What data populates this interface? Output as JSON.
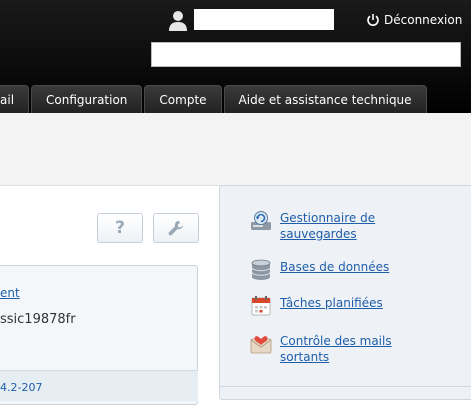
{
  "header": {
    "logout_label": "Déconnexion"
  },
  "nav": {
    "tabs": [
      {
        "label": "ail"
      },
      {
        "label": "Configuration"
      },
      {
        "label": "Compte"
      },
      {
        "label": "Aide et assistance technique"
      }
    ]
  },
  "toolbar": {
    "help_label": "?"
  },
  "panel": {
    "link_text": "ent",
    "value_text": "ssic19878fr",
    "footer_link": "4.2-207"
  },
  "sidebar": {
    "items": [
      {
        "label": "Gestionnaire de\nsauvegardes",
        "icon": "backup-manager-icon"
      },
      {
        "label": "Bases de données",
        "icon": "database-icon"
      },
      {
        "label": "Tâches planifiées",
        "icon": "calendar-icon"
      },
      {
        "label": "Contrôle des mails\nsortants",
        "icon": "mail-icon"
      }
    ]
  },
  "colors": {
    "link": "#1f5ea8",
    "topbar": "#0b0b0b",
    "sidebar_bg": "#eef2f6"
  }
}
